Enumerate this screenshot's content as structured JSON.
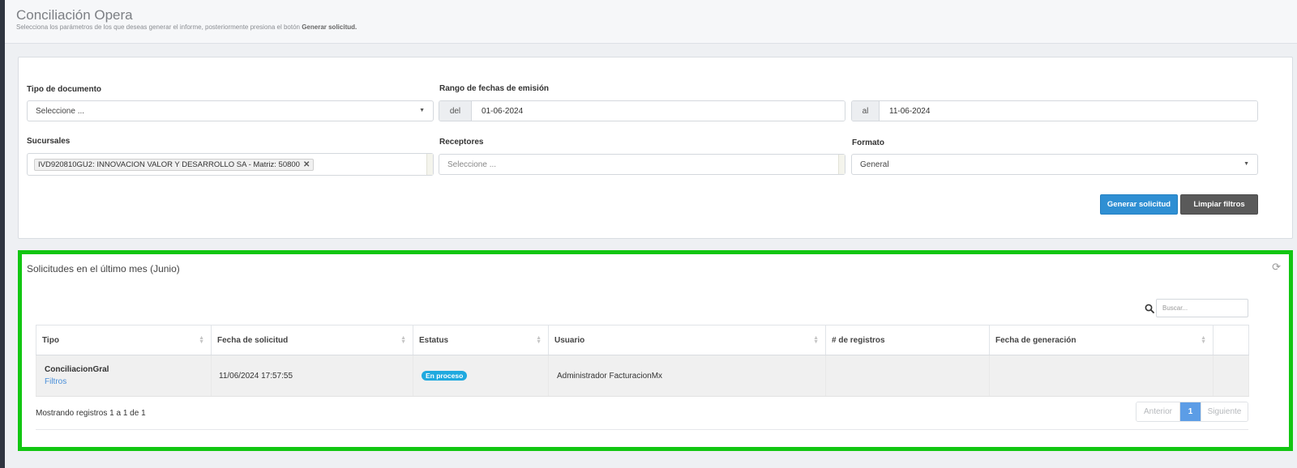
{
  "header": {
    "title": "Conciliación Opera",
    "subtitle_prefix": "Selecciona los parámetros de los que deseas generar el informe, posteriormente presiona el botón ",
    "subtitle_bold": "Generar solicitud."
  },
  "filters": {
    "tipo_label": "Tipo de documento",
    "tipo_value": "Seleccione ...",
    "rango_label": "Rango de fechas de emisión",
    "del_label": "del",
    "del_value": "01-06-2024",
    "al_label": "al",
    "al_value": "11-06-2024",
    "sucursales_label": "Sucursales",
    "sucursales_tag": "IVD920810GU2: INNOVACION VALOR Y DESARROLLO SA - Matriz: 50800",
    "receptores_label": "Receptores",
    "receptores_placeholder": "Seleccione ...",
    "formato_label": "Formato",
    "formato_value": "General",
    "generar_label": "Generar solicitud",
    "limpiar_label": "Limpiar filtros"
  },
  "results": {
    "title": "Solicitudes en el último mes (Junio)",
    "search_placeholder": "Buscar...",
    "columns": [
      "Tipo",
      "Fecha de solicitud",
      "Estatus",
      "Usuario",
      "# de registros",
      "Fecha de generación",
      ""
    ],
    "rows": [
      {
        "tipo": "ConciliacionGral",
        "link": "Filtros",
        "fecha": "11/06/2024 17:57:55",
        "estatus": "En proceso",
        "usuario": "Administrador FacturacionMx",
        "registros": "",
        "fecha_generacion": ""
      }
    ],
    "info": "Mostrando registros 1 a 1 de 1",
    "pager": {
      "prev": "Anterior",
      "page": "1",
      "next": "Siguiente"
    }
  },
  "colors": {
    "accent": "#2f8fd3",
    "highlight_border": "#11c611",
    "badge": "#1fa9df"
  }
}
